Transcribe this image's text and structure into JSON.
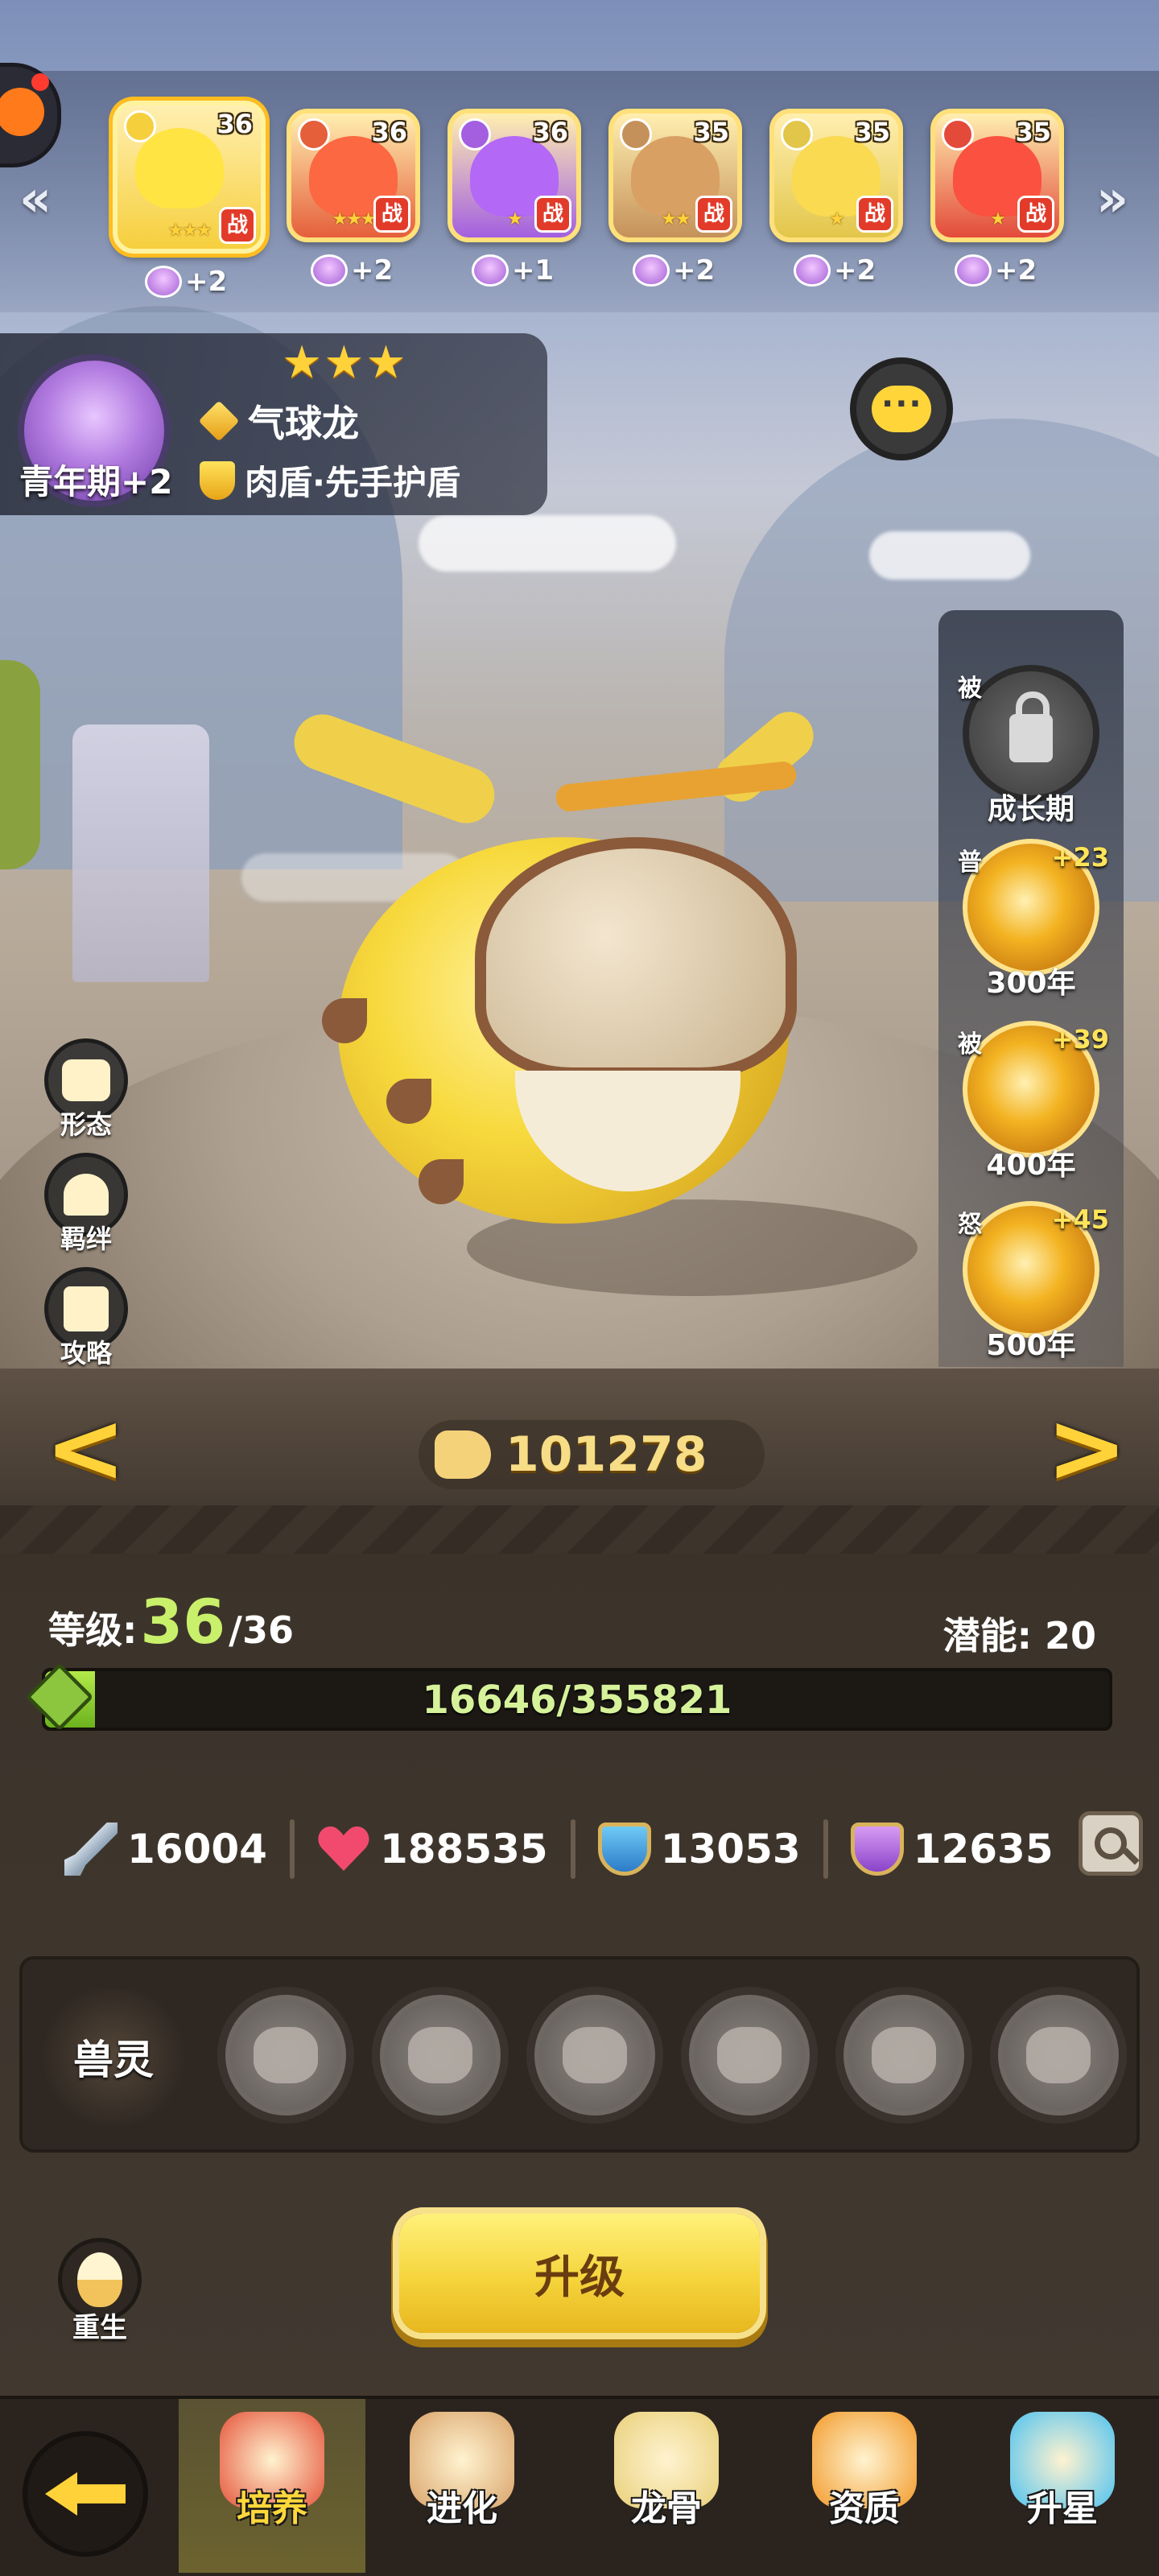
{
  "roster": {
    "pets": [
      {
        "level": "36",
        "war": "战",
        "stars": "★★★",
        "plus": "+2",
        "color": "#f6cf3d"
      },
      {
        "level": "36",
        "war": "战",
        "stars": "★★★",
        "plus": "+2",
        "color": "#e55f3b"
      },
      {
        "level": "36",
        "war": "战",
        "stars": "★",
        "plus": "+1",
        "color": "#a35fe0"
      },
      {
        "level": "35",
        "war": "战",
        "stars": "★★",
        "plus": "+2",
        "color": "#c5915a"
      },
      {
        "level": "35",
        "war": "战",
        "stars": "★",
        "plus": "+2",
        "color": "#e2c64a"
      },
      {
        "level": "35",
        "war": "战",
        "stars": "★",
        "plus": "+2",
        "color": "#e34a3a"
      }
    ],
    "prev_arrow": "«",
    "next_arrow": "»"
  },
  "pet": {
    "growth_stage": "青年期+2",
    "stars": "★★★",
    "name": "气球龙",
    "trait": "肉盾·先手护盾",
    "power": "101278"
  },
  "side_buttons": {
    "form": "形态",
    "bond": "羁绊",
    "guide": "攻略"
  },
  "skills": [
    {
      "tag": "被",
      "bonus": "",
      "caption": "成长期",
      "locked": true
    },
    {
      "tag": "普",
      "bonus": "+23",
      "caption": "300年",
      "locked": false
    },
    {
      "tag": "被",
      "bonus": "+39",
      "caption": "400年",
      "locked": false
    },
    {
      "tag": "怒",
      "bonus": "+45",
      "caption": "500年",
      "locked": false
    }
  ],
  "nav": {
    "prev": "<",
    "next": ">"
  },
  "level": {
    "label": "等级: ",
    "current": "36",
    "max": "/36",
    "potential_label": "潜能: ",
    "potential": "20",
    "exp_text": "16646/355821",
    "exp_fraction": 0.0468
  },
  "stats": {
    "attack": "16004",
    "hp": "188535",
    "defense": "13053",
    "magic_defense": "12635"
  },
  "spirit": {
    "label": "兽灵",
    "slot_count": 6
  },
  "rebirth_label": "重生",
  "upgrade_label": "升级",
  "tabs": [
    {
      "label": "培养",
      "active": true,
      "color": "#e5533a"
    },
    {
      "label": "进化",
      "active": false,
      "color": "#d9a36a"
    },
    {
      "label": "龙骨",
      "active": false,
      "color": "#e9d07a"
    },
    {
      "label": "资质",
      "active": false,
      "color": "#f29a2a"
    },
    {
      "label": "升星",
      "active": false,
      "color": "#4fc2f0"
    }
  ],
  "colors": {
    "accent_gold": "#ffd23a",
    "exp_green": "#8cc63f",
    "level_green": "#c9f06a"
  }
}
